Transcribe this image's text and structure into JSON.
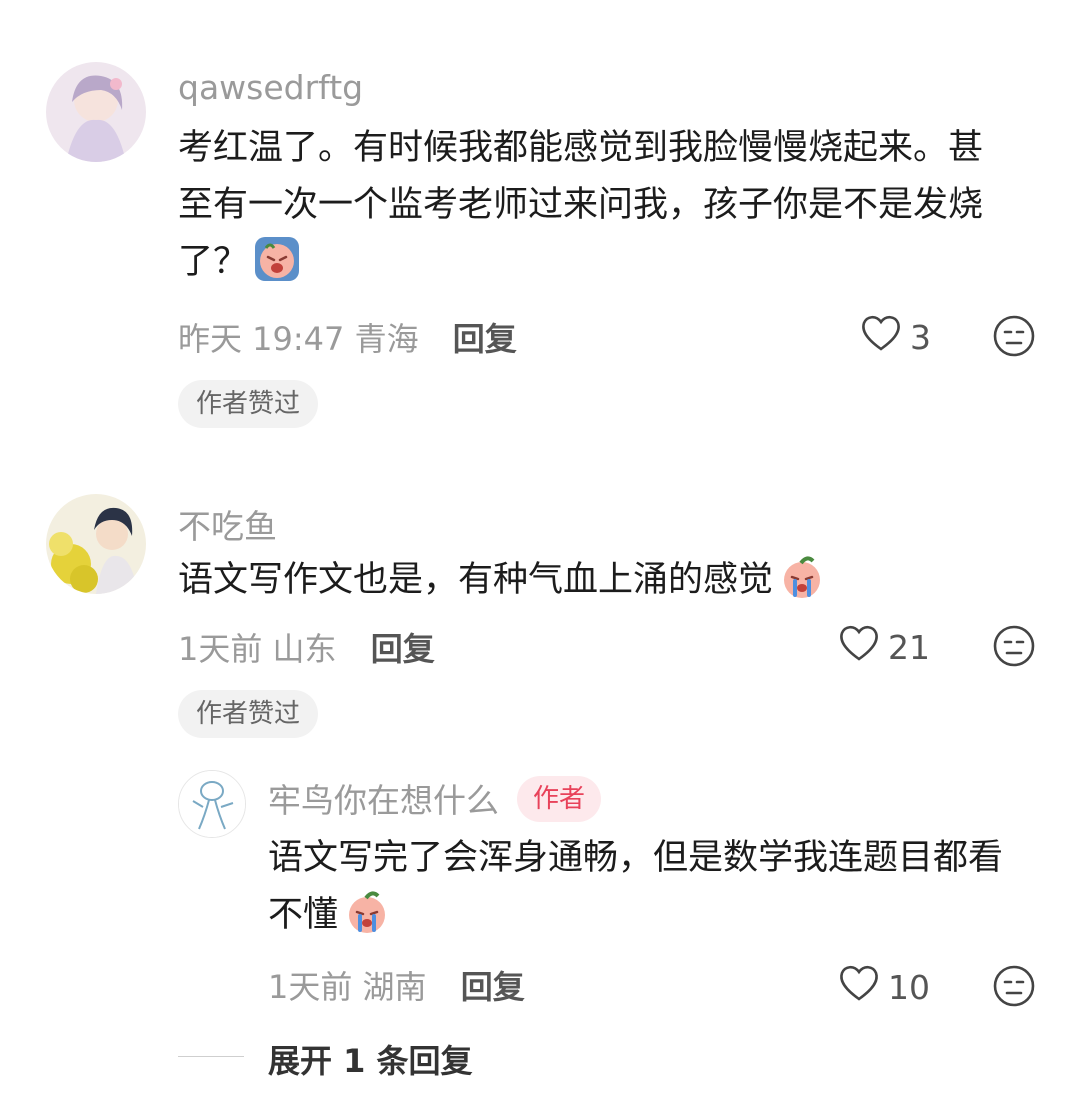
{
  "comments": [
    {
      "username": "qawsedrftg",
      "text": "考红温了。有时候我都能感觉到我脸慢慢烧起来。甚至有一次一个监考老师过来问我，孩子你是不是发烧了？",
      "emoji": "sob-face-emoji",
      "time": "昨天 19:47",
      "location": "青海",
      "reply_label": "回复",
      "likes": "3",
      "badge": "作者赞过"
    },
    {
      "username": "不吃鱼",
      "text": "语文写作文也是，有种气血上涌的感觉",
      "emoji": "crying-face-emoji",
      "time": "1天前",
      "location": "山东",
      "reply_label": "回复",
      "likes": "21",
      "badge": "作者赞过"
    }
  ],
  "reply": {
    "username": "牢鸟你在想什么",
    "author_tag": "作者",
    "text": "语文写完了会浑身通畅，但是数学我连题目都看不懂",
    "emoji": "crying-face-emoji",
    "time": "1天前",
    "location": "湖南",
    "reply_label": "回复",
    "likes": "10"
  },
  "expand_label": "展开 1 条回复",
  "colors": {
    "username": "#9a9a9a",
    "author_tag_text": "#e8425a",
    "author_tag_bg": "#fde9ec",
    "badge_bg": "#f2f2f2"
  }
}
